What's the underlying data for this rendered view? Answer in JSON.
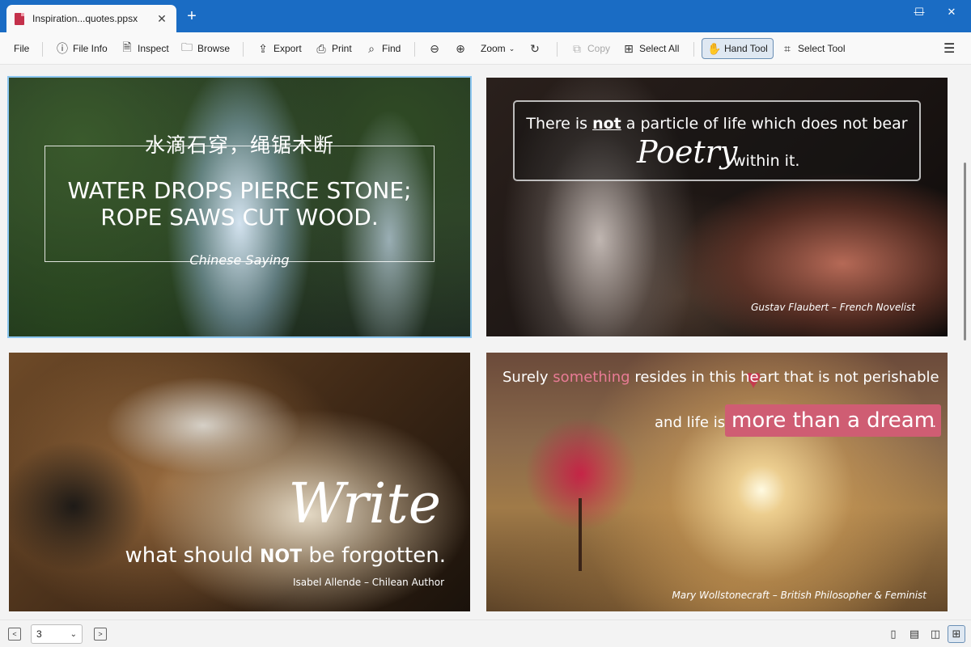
{
  "window": {
    "tab_title": "Inspiration...quotes.ppsx",
    "tab_close": "✕",
    "new_tab": "+",
    "minimize": "—",
    "maximize": "☐",
    "close": "✕"
  },
  "toolbar": {
    "file": "File",
    "file_info": "File Info",
    "inspect": "Inspect",
    "browse": "Browse",
    "export": "Export",
    "print": "Print",
    "find": "Find",
    "zoom": "Zoom",
    "copy": "Copy",
    "select_all": "Select All",
    "hand_tool": "Hand Tool",
    "select_tool": "Select Tool",
    "menu": "☰"
  },
  "slides": {
    "s1": {
      "chinese": "水滴石穿，绳锯木断",
      "line1": "WATER DROPS PIERCE STONE;",
      "line2": "ROPE SAWS CUT WOOD.",
      "source": "Chinese Saying"
    },
    "s2": {
      "pre": "There is ",
      "not": "not",
      "post": " a particle of life which does not bear",
      "poetry": "Poetry",
      "within": "within it.",
      "attr": "Gustav Flaubert – French Novelist"
    },
    "s3": {
      "write": "Write",
      "pre": "what should ",
      "not": "NOT",
      "post": " be forgotten.",
      "attr": "Isabel Allende – Chilean Author"
    },
    "s4": {
      "pre": "Surely ",
      "something": "something",
      "mid": " resides in this heart that is not perishable",
      "and": "and life is",
      "dream": "more than a dream",
      "dot": ".",
      "attr": "Mary Wollstonecraft – British Philosopher & Feminist"
    }
  },
  "status": {
    "page": "3",
    "prev": "<",
    "next": ">"
  }
}
